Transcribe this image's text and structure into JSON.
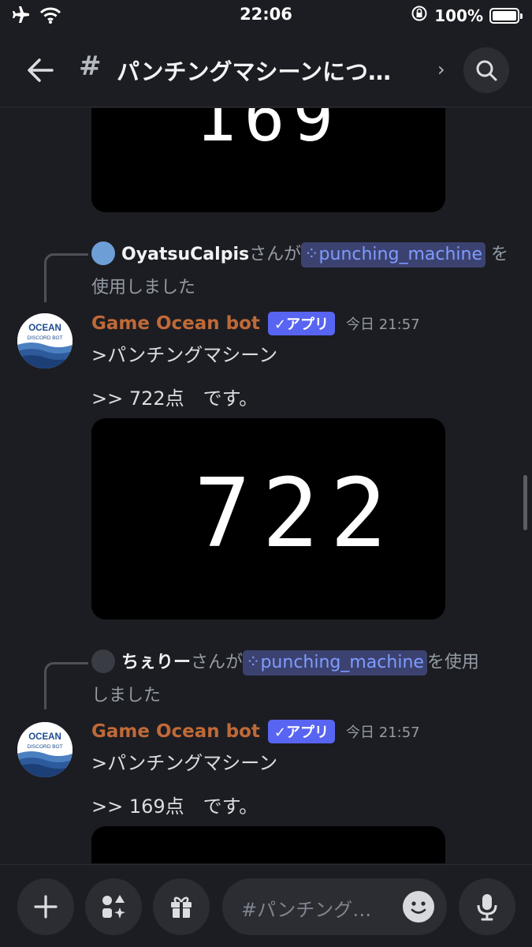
{
  "status_bar": {
    "time": "22:06",
    "battery_text": "100%"
  },
  "header": {
    "hash": "#",
    "channel_title": "パンチングマシーンにつ…",
    "chevron": "›"
  },
  "messages": [
    {
      "score_image_digits": "169"
    },
    {
      "command": {
        "user": "OyatsuCalpis",
        "pre": "さんが",
        "command_name": "punching_machine",
        "post_line1": "を",
        "post_line2": "使用しました"
      },
      "bot_name": "Game Ocean bot",
      "badge": "アプリ",
      "timestamp": "今日 21:57",
      "line1": ">パンチングマシーン",
      "line2": ">> 722点　です。",
      "score_image_digits": "722"
    },
    {
      "command": {
        "user": "ちぇりー",
        "pre": "さんが",
        "command_name": "punching_machine",
        "post_line1": "を使用",
        "post_line2": "しました"
      },
      "bot_name": "Game Ocean bot",
      "badge": "アプリ",
      "timestamp": "今日 21:57",
      "line1": ">パンチングマシーン",
      "line2": ">> 169点　です。"
    }
  ],
  "avatar_logo": {
    "line1": "OCEAN",
    "line2": "DISCORD BOT"
  },
  "composer": {
    "placeholder": "#パンチング…"
  },
  "colors": {
    "background": "#1c1d22",
    "bot_name": "#c06a38",
    "app_badge": "#5865f2",
    "command_pill": "#3c4270",
    "command_text": "#7e9cff"
  }
}
